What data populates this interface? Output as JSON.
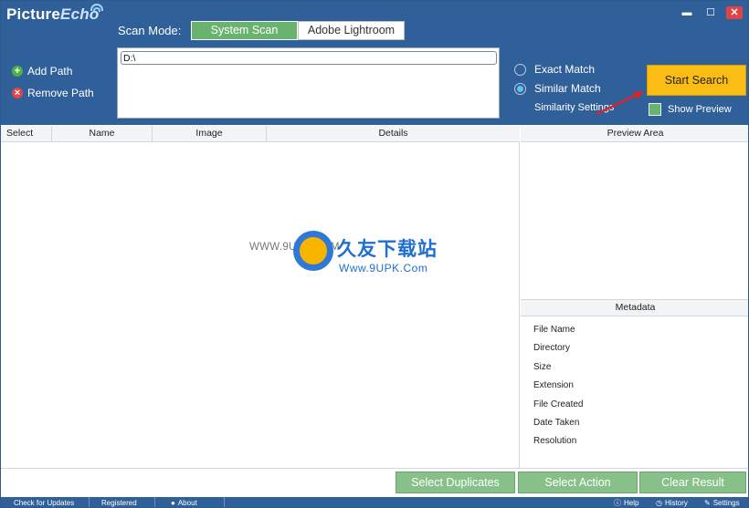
{
  "app": {
    "logo_main": "Picture",
    "logo_accent": "Echo"
  },
  "window": {
    "minimize": "▬",
    "maximize": "☐",
    "close": "✕"
  },
  "scan_mode": {
    "label": "Scan Mode:",
    "options": [
      "System Scan",
      "Adobe Lightroom"
    ],
    "selected": "System Scan"
  },
  "paths": {
    "add_label": "Add Path",
    "remove_label": "Remove Path",
    "value": "D:\\"
  },
  "match": {
    "exact_label": "Exact Match",
    "similar_label": "Similar Match",
    "selected": "Similar Match",
    "settings_label": "Similarity Settings"
  },
  "search": {
    "start_label": "Start Search",
    "preview_label": "Show Preview",
    "preview_checked": true
  },
  "table": {
    "columns": [
      "Select",
      "Name",
      "Image",
      "Details"
    ]
  },
  "watermark": {
    "www": "WWW.9UPK.COM",
    "cn": "久友下载站",
    "url": "Www.9UPK.Com"
  },
  "preview": {
    "header": "Preview Area"
  },
  "metadata": {
    "header": "Metadata",
    "fields": [
      "File Name",
      "Directory",
      "Size",
      "Extension",
      "File Created",
      "Date Taken",
      "Resolution"
    ]
  },
  "actions": {
    "select_duplicates": "Select Duplicates",
    "select_action": "Select Action",
    "clear_result": "Clear Result"
  },
  "status_bar": {
    "check_updates": "Check for Updates",
    "registered": "Registered",
    "about": "About",
    "help": "Help",
    "history": "History",
    "settings": "Settings"
  },
  "colors": {
    "header_bg": "#30609a",
    "accent_green": "#6ab36e",
    "start_yellow": "#fbbd14"
  }
}
